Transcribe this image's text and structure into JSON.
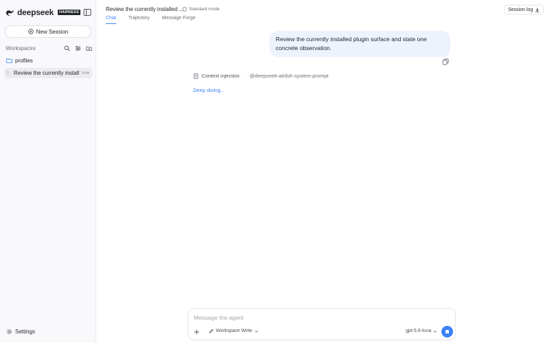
{
  "brand": {
    "name": "deepseek",
    "badge": "HARNESS"
  },
  "sidebar": {
    "new_session_label": "New Session",
    "workspaces_title": "Workspaces",
    "folder_label": "profiles",
    "session": {
      "index": "1",
      "title": "Review the currently installed plugin surface and state one concrete observation.",
      "time": "now"
    },
    "settings_label": "Settings"
  },
  "header": {
    "title": "Review the currently installed ...",
    "mode_label": "Standard mode",
    "tabs": [
      {
        "label": "Chat"
      },
      {
        "label": "Trajectory"
      },
      {
        "label": "Message Forge"
      }
    ],
    "session_log_label": "Session log"
  },
  "chat": {
    "user_message": "Review the currently installed plugin surface and state one concrete observation.",
    "context_label": "Context injection",
    "context_sep": "·",
    "context_ref": "@deepseek-ai/dsh-system-prompt",
    "status_text": "Deep diving..."
  },
  "composer": {
    "placeholder": "Message the agent",
    "permission_label": "Workspace Write",
    "model_label": "gpt-5.6-luna"
  },
  "colors": {
    "accent": "#3b82f6",
    "bubble": "#eef2fd",
    "sidebar_bg": "#f9f9fb"
  }
}
